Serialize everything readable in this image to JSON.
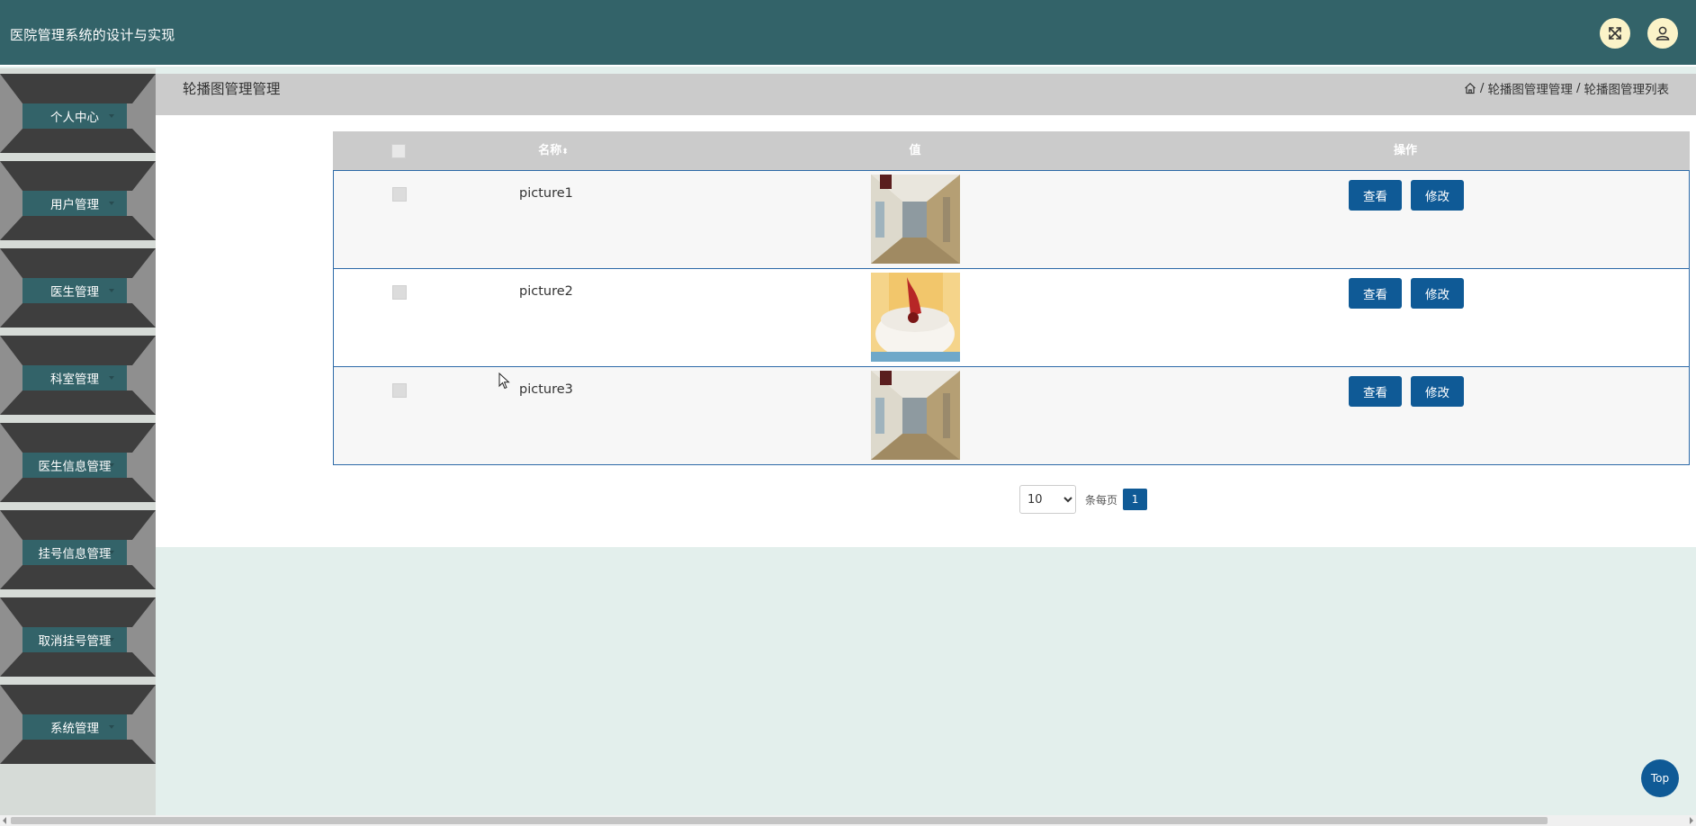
{
  "header": {
    "title": "医院管理系统的设计与实现"
  },
  "sidebar": {
    "items": [
      {
        "label": "个人中心"
      },
      {
        "label": "用户管理"
      },
      {
        "label": "医生管理"
      },
      {
        "label": "科室管理"
      },
      {
        "label": "医生信息管理"
      },
      {
        "label": "挂号信息管理"
      },
      {
        "label": "取消挂号管理"
      },
      {
        "label": "系统管理"
      }
    ]
  },
  "breadcrumb": {
    "page_title": "轮播图管理管理",
    "sep": "/",
    "level1": "轮播图管理管理",
    "level2": "轮播图管理列表"
  },
  "table": {
    "columns": {
      "name": "名称",
      "value": "值",
      "actions": "操作"
    },
    "rows": [
      {
        "name": "picture1",
        "image": "hallway"
      },
      {
        "name": "picture2",
        "image": "bowl"
      },
      {
        "name": "picture3",
        "image": "hallway"
      }
    ],
    "view_label": "查看",
    "edit_label": "修改"
  },
  "pagination": {
    "page_size": "10",
    "page_size_options": [
      "10"
    ],
    "per_page_label": "条每页",
    "current_page": "1"
  },
  "top_button": "Top",
  "colors": {
    "header_bg": "#336369",
    "primary_button": "#0f5a96",
    "row_border": "#2d6aa8",
    "page_bg": "#e3efec"
  }
}
